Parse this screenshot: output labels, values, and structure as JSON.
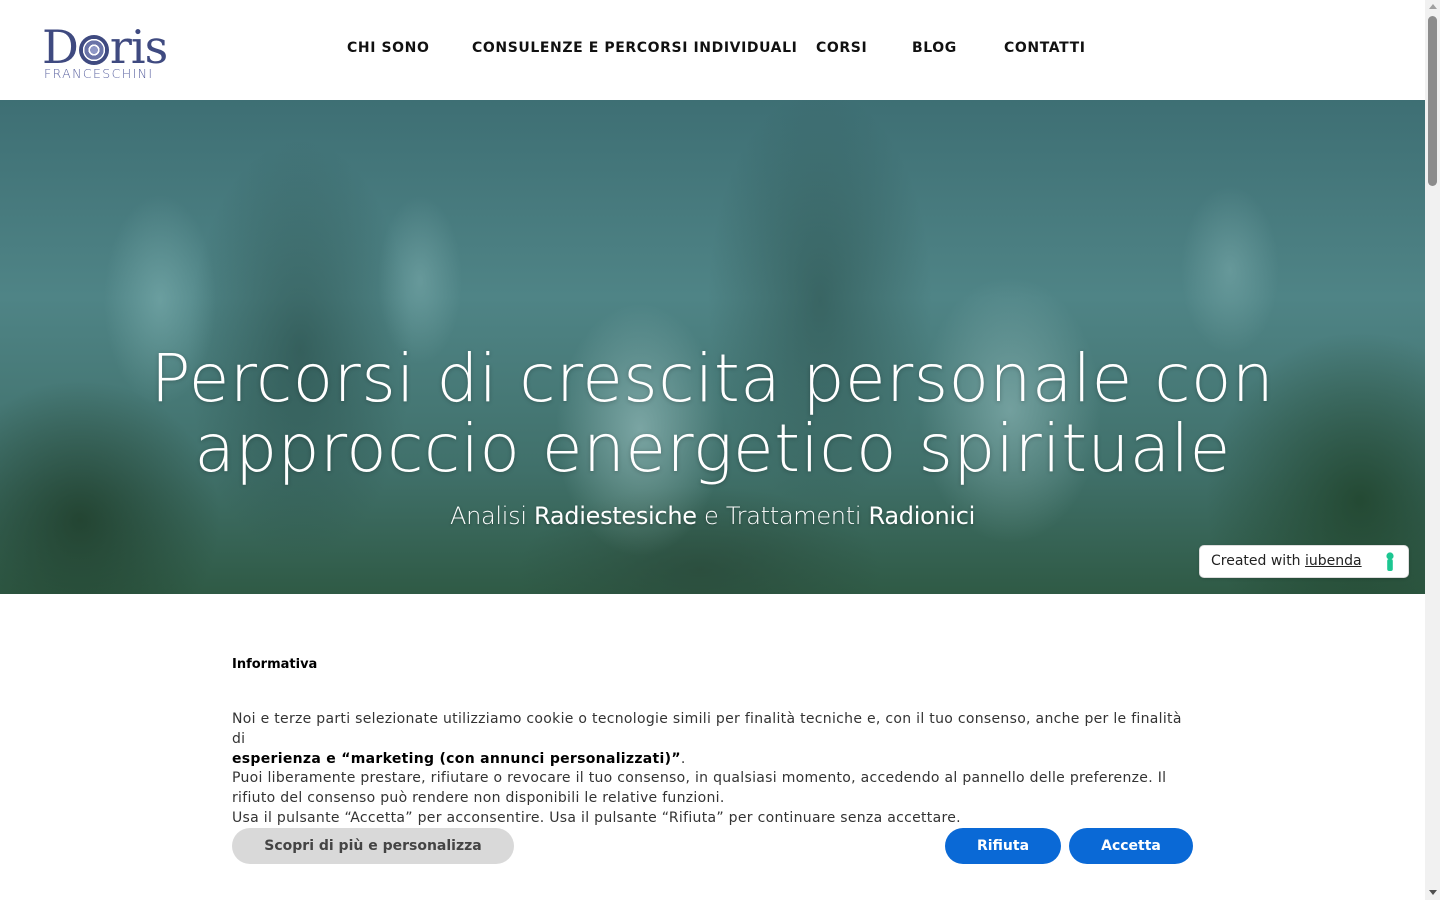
{
  "logo": {
    "name_prefix": "D",
    "name_suffix": "ris",
    "surname": "FRANCESCHINI"
  },
  "nav": {
    "items": [
      {
        "label": "CHI SONO"
      },
      {
        "label": "CONSULENZE E PERCORSI INDIVIDUALI"
      },
      {
        "label": "CORSI"
      },
      {
        "label": "BLOG"
      },
      {
        "label": "CONTATTI"
      }
    ]
  },
  "hero": {
    "title_line1": "Percorsi di crescita personale con",
    "title_line2": "approccio energetico spirituale",
    "subtitle_part1": "Analisi ",
    "subtitle_part2": "Radiestesiche",
    "subtitle_part3": " e Trattamenti ",
    "subtitle_part4": "Radionici"
  },
  "iubenda_badge": {
    "text": "Created with ",
    "link": "iubenda",
    "accent_color": "#1cc691"
  },
  "cookie_banner": {
    "title": "Informativa",
    "line1": "Noi e terze parti selezionate utilizziamo cookie o tecnologie simili per finalità tecniche e, con il tuo consenso, anche per le finalità di",
    "line1_bold": "esperienza e “marketing (con annunci personalizzati)”",
    "line1_end": ".",
    "line2": "Puoi liberamente prestare, rifiutare o revocare il tuo consenso, in qualsiasi momento, accedendo al pannello delle preferenze. Il rifiuto del consenso può rendere non disponibili le relative funzioni.",
    "line3": "Usa il pulsante “Accetta” per acconsentire. Usa il pulsante “Rifiuta” per continuare senza accettare.",
    "btn_more": "Scopri di più e personalizza",
    "btn_reject": "Rifiuta",
    "btn_accept": "Accetta",
    "button_color": "#0a69d6"
  }
}
